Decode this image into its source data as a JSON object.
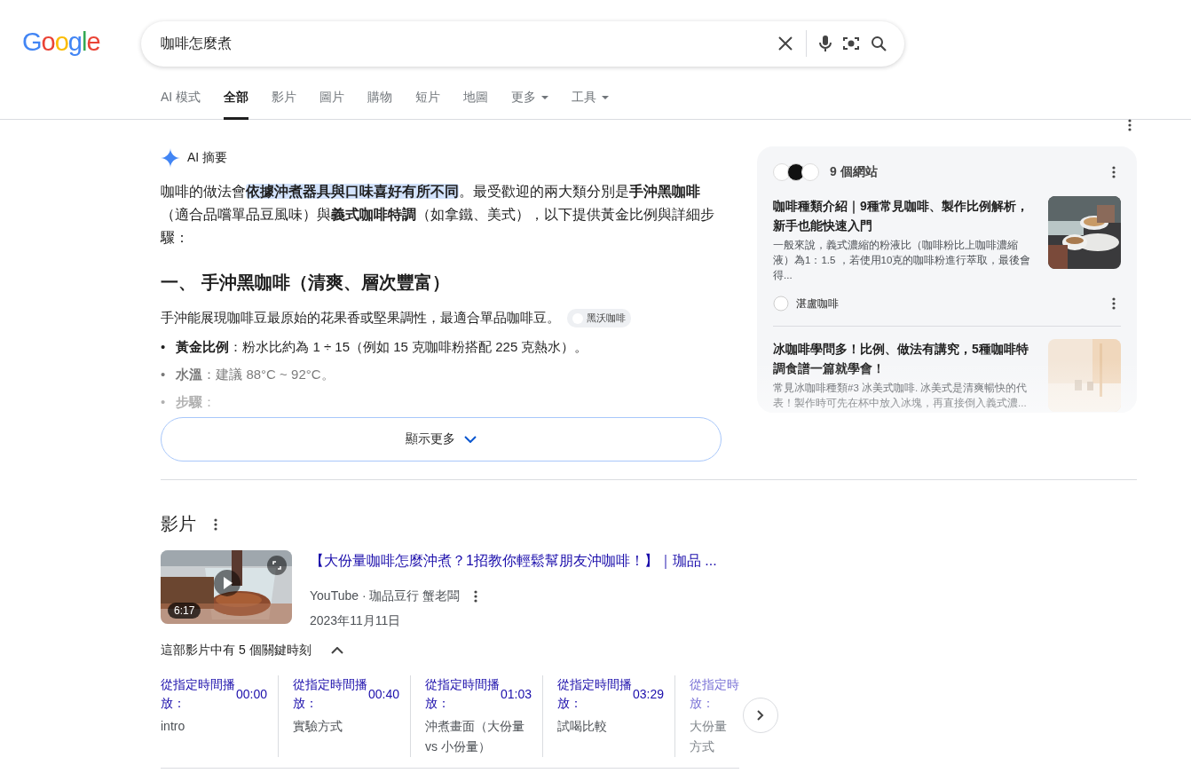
{
  "logo": {
    "letters": [
      {
        "char": "G",
        "color": "#4285f4"
      },
      {
        "char": "o",
        "color": "#ea4335"
      },
      {
        "char": "o",
        "color": "#fbbc05"
      },
      {
        "char": "g",
        "color": "#4285f4"
      },
      {
        "char": "l",
        "color": "#34a853"
      },
      {
        "char": "e",
        "color": "#ea4335"
      }
    ]
  },
  "search": {
    "value": "咖啡怎麼煮"
  },
  "tabs": [
    {
      "label": "AI 模式",
      "selected": false,
      "dropdown": false
    },
    {
      "label": "全部",
      "selected": true,
      "dropdown": false
    },
    {
      "label": "影片",
      "selected": false,
      "dropdown": false
    },
    {
      "label": "圖片",
      "selected": false,
      "dropdown": false
    },
    {
      "label": "購物",
      "selected": false,
      "dropdown": false
    },
    {
      "label": "短片",
      "selected": false,
      "dropdown": false
    },
    {
      "label": "地圖",
      "selected": false,
      "dropdown": false
    },
    {
      "label": "更多",
      "selected": false,
      "dropdown": true
    },
    {
      "label": "工具",
      "selected": false,
      "dropdown": true
    }
  ],
  "ai_overview": {
    "title": "AI 摘要",
    "intro": [
      {
        "text": "咖啡的做法會",
        "kind": "plain"
      },
      {
        "text": "依據沖煮器具與口味喜好有所不同",
        "kind": "highlight"
      },
      {
        "text": "。最受歡迎的兩大類分別是",
        "kind": "plain"
      },
      {
        "text": "手沖黑咖啡",
        "kind": "bold"
      },
      {
        "text": "（適合品嚐單品豆風味）與",
        "kind": "plain"
      },
      {
        "text": "義式咖啡特調",
        "kind": "bold"
      },
      {
        "text": "（如拿鐵、美式），以下提供黃金比例與詳細步驟：",
        "kind": "plain"
      }
    ],
    "heading": "一、 手沖黑咖啡（清爽、層次豐富）",
    "paragraph": "手沖能展現咖啡豆最原始的花果香或堅果調性，最適合單品咖啡豆。",
    "source_chip": "黑沃咖啡",
    "bullets": [
      {
        "marker": "•",
        "label": "黃金比例",
        "text": "：粉水比約為 1 ÷ 15（例如 15 克咖啡粉搭配 225 克熱水）。"
      },
      {
        "marker": "•",
        "label": "水溫",
        "text": "：建議 88°C ~ 92°C。"
      },
      {
        "marker": "•",
        "label": "步驟",
        "text": "："
      }
    ],
    "show_more": "顯示更多",
    "sources": {
      "count": "9 個網站",
      "items": [
        {
          "title": "咖啡種類介紹｜9種常見咖啡、製作比例解析，新手也能快速入門",
          "snippet": "一般來說，義式濃縮的粉液比（咖啡粉比上咖啡濃縮液）為1：1.5 ，若使用10克的咖啡粉進行萃取，最後會得...",
          "site": "湛盧咖啡",
          "kind": "picture"
        },
        {
          "title": "冰咖啡學問多！比例、做法有講究，5種咖啡特調食譜一篇就學會！",
          "snippet": "常見冰咖啡種類#3 冰美式咖啡. 冰美式是清爽暢快的代表！製作時可先在杯中放入冰塊，再直接倒入義式濃...",
          "kind": "picture"
        }
      ]
    }
  },
  "videos": {
    "title": "影片",
    "video": {
      "title": "【大份量咖啡怎麼沖煮？1招教你輕鬆幫朋友沖咖啡！】｜珈品 ...",
      "source": "YouTube · 珈品豆行 蟹老闆",
      "date": "2023年11月11日",
      "duration": "6:17",
      "kind": "picture"
    },
    "moments_title": "這部影片中有 5 個關鍵時刻",
    "expanded": true,
    "moments": [
      {
        "label_lines": [
          "從指定時間播",
          "放："
        ],
        "time": "00:00",
        "title_lines": [
          "intro"
        ],
        "faded": false
      },
      {
        "label_lines": [
          "從指定時間播",
          "放："
        ],
        "time": "00:40",
        "title_lines": [
          "實驗方式"
        ],
        "faded": false
      },
      {
        "label_lines": [
          "從指定時間播",
          "放："
        ],
        "time": "01:03",
        "title_lines": [
          "沖煮畫面（大份量",
          "vs 小份量）"
        ],
        "faded": false
      },
      {
        "label_lines": [
          "從指定時間播",
          "放："
        ],
        "time": "03:29",
        "title_lines": [
          "試喝比較"
        ],
        "faded": false
      },
      {
        "label_lines": [
          "從指定時",
          "放："
        ],
        "title_lines": [
          "大份量",
          "方式"
        ],
        "faded": true
      }
    ]
  }
}
